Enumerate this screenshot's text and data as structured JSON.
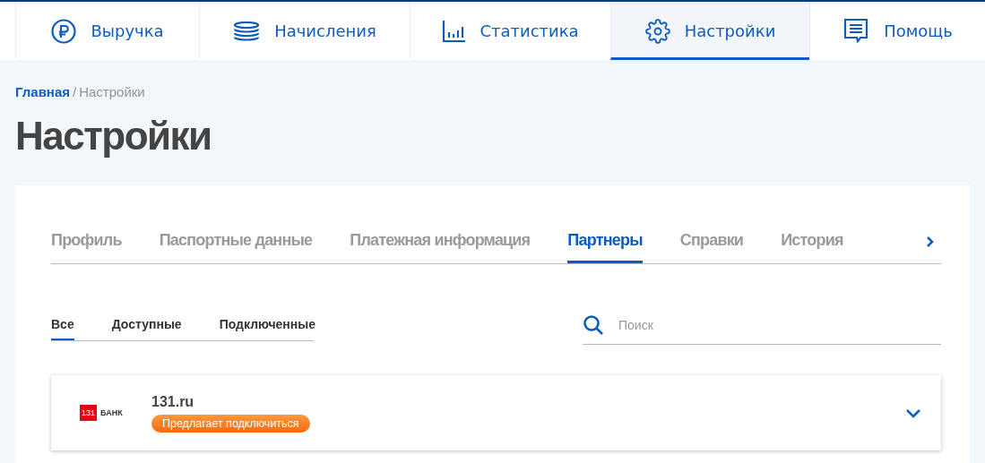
{
  "nav": [
    {
      "label": "Выручка",
      "selected": false
    },
    {
      "label": "Начисления",
      "selected": false
    },
    {
      "label": "Статистика",
      "selected": false
    },
    {
      "label": "Настройки",
      "selected": true
    },
    {
      "label": "Помощь",
      "selected": false
    }
  ],
  "breadcrumb": {
    "link": "Главная",
    "separator": "/",
    "current": "Настройки"
  },
  "title": "Настройки",
  "tabs": [
    {
      "label": "Профиль",
      "selected": false
    },
    {
      "label": "Паспортные данные",
      "selected": false
    },
    {
      "label": "Платежная информация",
      "selected": false
    },
    {
      "label": "Партнеры",
      "selected": true
    },
    {
      "label": "Справки",
      "selected": false
    },
    {
      "label": "История",
      "selected": false
    }
  ],
  "filters": [
    {
      "label": "Все",
      "selected": true
    },
    {
      "label": "Доступные",
      "selected": false
    },
    {
      "label": "Подключенные",
      "selected": false
    }
  ],
  "search": {
    "placeholder": "Поиск"
  },
  "partners": [
    {
      "logo_number": "131",
      "logo_text": "БАНК",
      "name": "131.ru",
      "badge": "Предлагает подключиться",
      "expanded": false
    }
  ]
}
